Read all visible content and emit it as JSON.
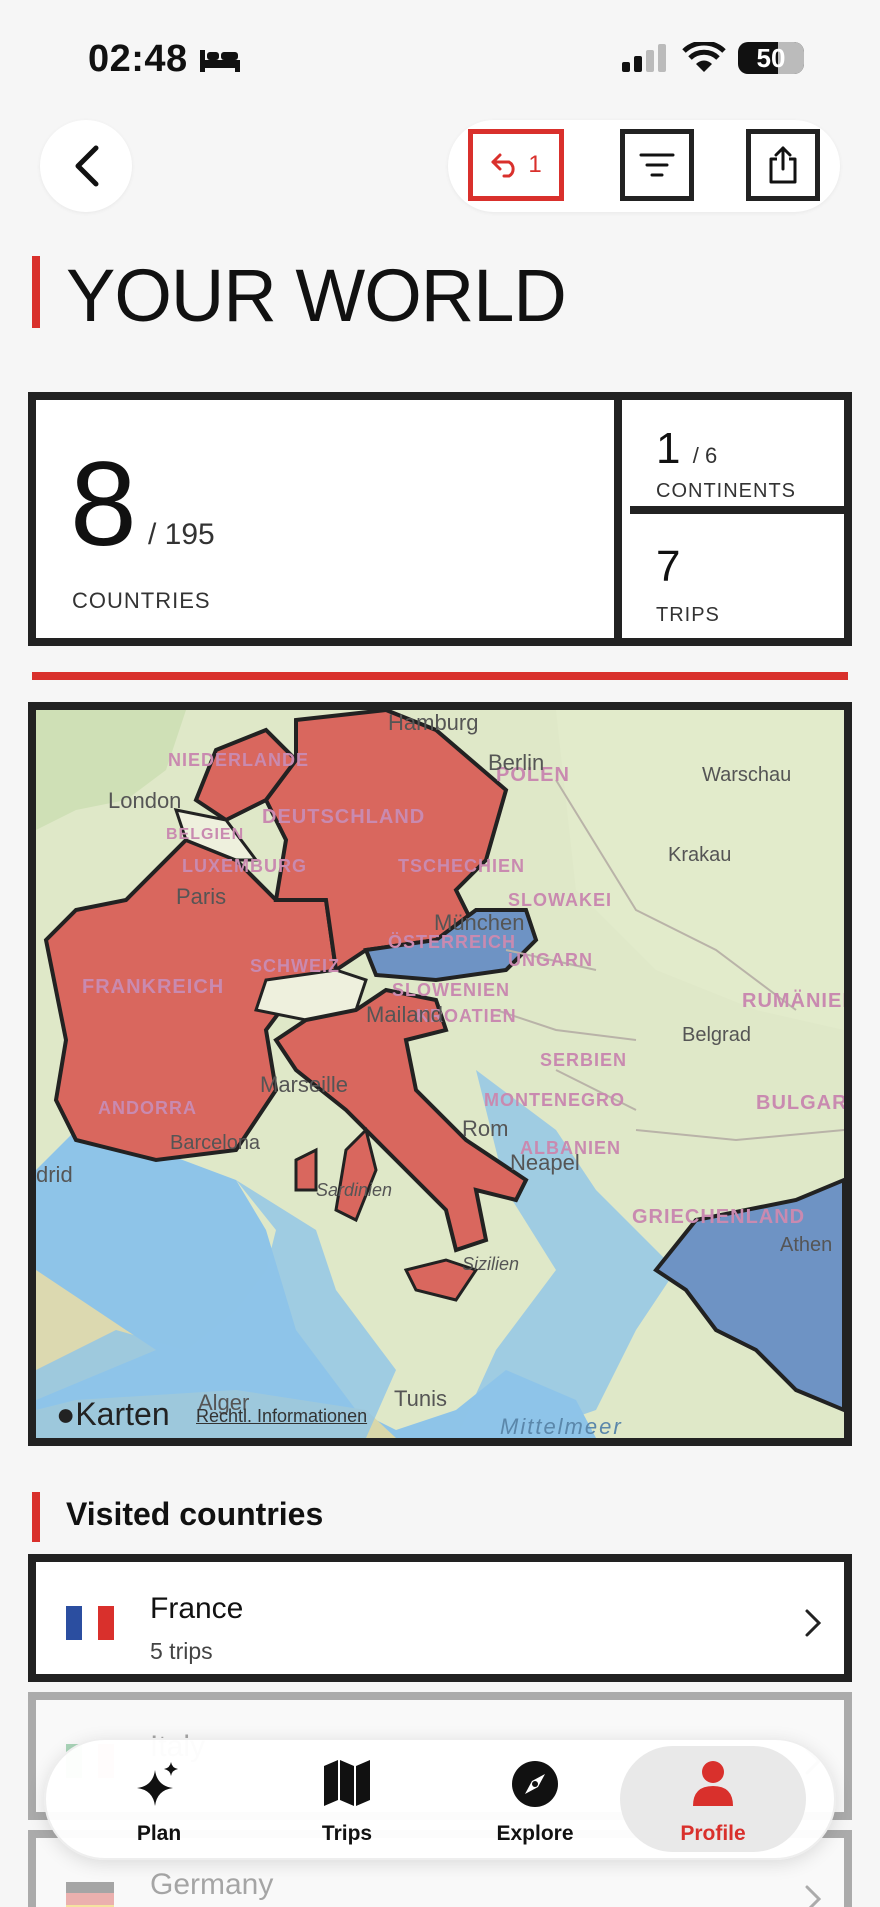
{
  "status": {
    "time": "02:48",
    "battery": "50"
  },
  "header": {
    "undo_count": "1"
  },
  "title": "YOUR WORLD",
  "stats": {
    "countries_value": "8",
    "countries_total": "/ 195",
    "countries_label": "COUNTRIES",
    "continents_value": "1",
    "continents_total": "/ 6",
    "continents_label": "CONTINENTS",
    "trips_value": "7",
    "trips_label": "TRIPS"
  },
  "map": {
    "countries": [
      "NIEDERLANDE",
      "DEUTSCHLAND",
      "BELGIEN",
      "LUXEMBURG",
      "FRANKREICH",
      "SCHWEIZ",
      "ÖSTERREICH",
      "TSCHECHIEN",
      "POLEN",
      "SLOWAKEI",
      "UNGARN",
      "SLOWENIEN",
      "KROATIEN",
      "RUMÄNIEN",
      "SERBIEN",
      "BULGAR",
      "MONTENEGRO",
      "ALBANIEN",
      "GRIECHENLAND",
      "ANDORRA"
    ],
    "cities": [
      "Hamburg",
      "Berlin",
      "Warschau",
      "London",
      "Krakau",
      "Paris",
      "München",
      "Mailand",
      "Belgrad",
      "Marseille",
      "Rom",
      "Barcelona",
      "Neapel",
      "drid",
      "Sardinien",
      "Athen",
      "Sizilien",
      "Alger",
      "Tunis"
    ],
    "sea": "Mittelmeer",
    "attribution": "Karten",
    "legal": "Rechtl. Informationen",
    "visited_color": "#d9675e",
    "planned_color": "#6e93c4"
  },
  "visited": {
    "title": "Visited countries",
    "items": [
      {
        "name": "France",
        "sub": "5 trips"
      },
      {
        "name": "Italy",
        "sub": ""
      },
      {
        "name": "Germany",
        "sub": ""
      }
    ]
  },
  "tabs": [
    {
      "label": "Plan",
      "icon": "sparkle-icon"
    },
    {
      "label": "Trips",
      "icon": "map-icon"
    },
    {
      "label": "Explore",
      "icon": "compass-icon"
    },
    {
      "label": "Profile",
      "icon": "person-icon",
      "active": true
    }
  ]
}
